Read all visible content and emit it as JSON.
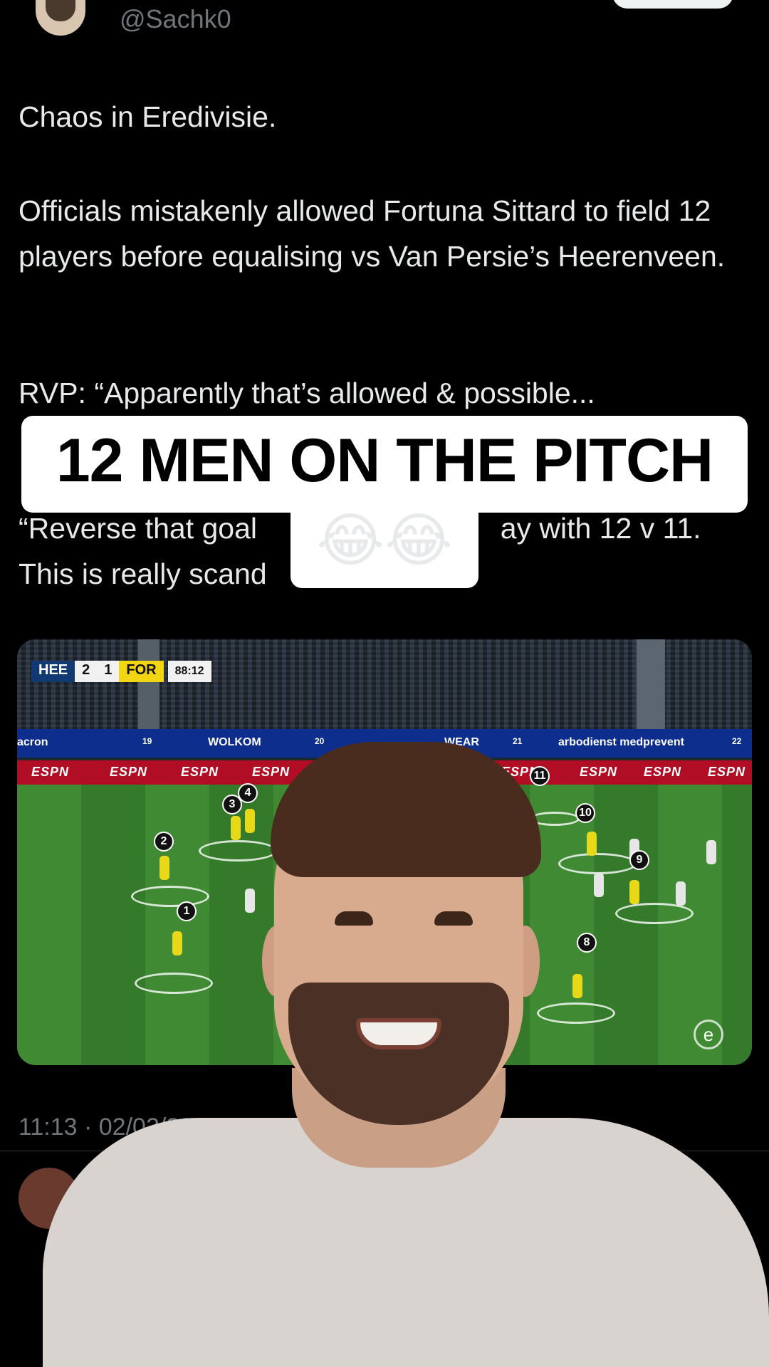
{
  "header": {
    "handle": "@Sachk0"
  },
  "tweet": {
    "p1": "Chaos in Eredivisie.",
    "p2": "Officials mistakenly allowed Fortuna Sittard to field 12 players before equalising vs Van Persie’s Heerenveen.",
    "p3": "RVP: “Apparently that’s allowed & possible...",
    "p4": "“Reverse that goal                              ay with 12 v 11.\nThis is really scand"
  },
  "caption": {
    "text": "12 MEN ON THE PITCH",
    "emoji": "😂😂"
  },
  "media": {
    "scorebug": {
      "home": "HEE",
      "home_score": "2",
      "away_score": "1",
      "away": "FOR",
      "clock": "88:12"
    },
    "boards": [
      "acron",
      "19",
      "WOLKOM",
      "20",
      "WEAR",
      "21",
      "arbodienst medprevent",
      "22"
    ],
    "espn": [
      "ESPN",
      "ESPN",
      "ESPN",
      "ESPN",
      "ESPN",
      "ESPN",
      "ESPN",
      "ESPN"
    ],
    "player_numbers": [
      "1",
      "2",
      "3",
      "4",
      "8",
      "9",
      "10",
      "11"
    ]
  },
  "footer": {
    "timestamp": "11:13 · 02/02/2025"
  },
  "colors": {
    "background": "#000000",
    "text": "#e7e9ea",
    "muted": "#71767b",
    "caption_bg": "#ffffff"
  }
}
